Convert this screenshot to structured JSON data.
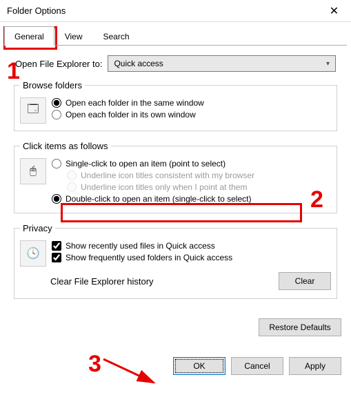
{
  "window": {
    "title": "Folder Options"
  },
  "tabs": {
    "general": "General",
    "view": "View",
    "search": "Search"
  },
  "open_explorer": {
    "label": "Open File Explorer to:",
    "value": "Quick access"
  },
  "browse": {
    "legend": "Browse folders",
    "same": "Open each folder in the same window",
    "own": "Open each folder in its own window"
  },
  "click_items": {
    "legend": "Click items as follows",
    "single": "Single-click to open an item (point to select)",
    "underline_browser": "Underline icon titles consistent with my browser",
    "underline_point": "Underline icon titles only when I point at them",
    "double": "Double-click to open an item (single-click to select)"
  },
  "privacy": {
    "legend": "Privacy",
    "recent_files": "Show recently used files in Quick access",
    "freq_folders": "Show frequently used folders in Quick access",
    "clear_label": "Clear File Explorer history",
    "clear_btn": "Clear"
  },
  "buttons": {
    "restore": "Restore Defaults",
    "ok": "OK",
    "cancel": "Cancel",
    "apply": "Apply"
  },
  "annotations": {
    "n1": "1",
    "n2": "2",
    "n3": "3"
  }
}
